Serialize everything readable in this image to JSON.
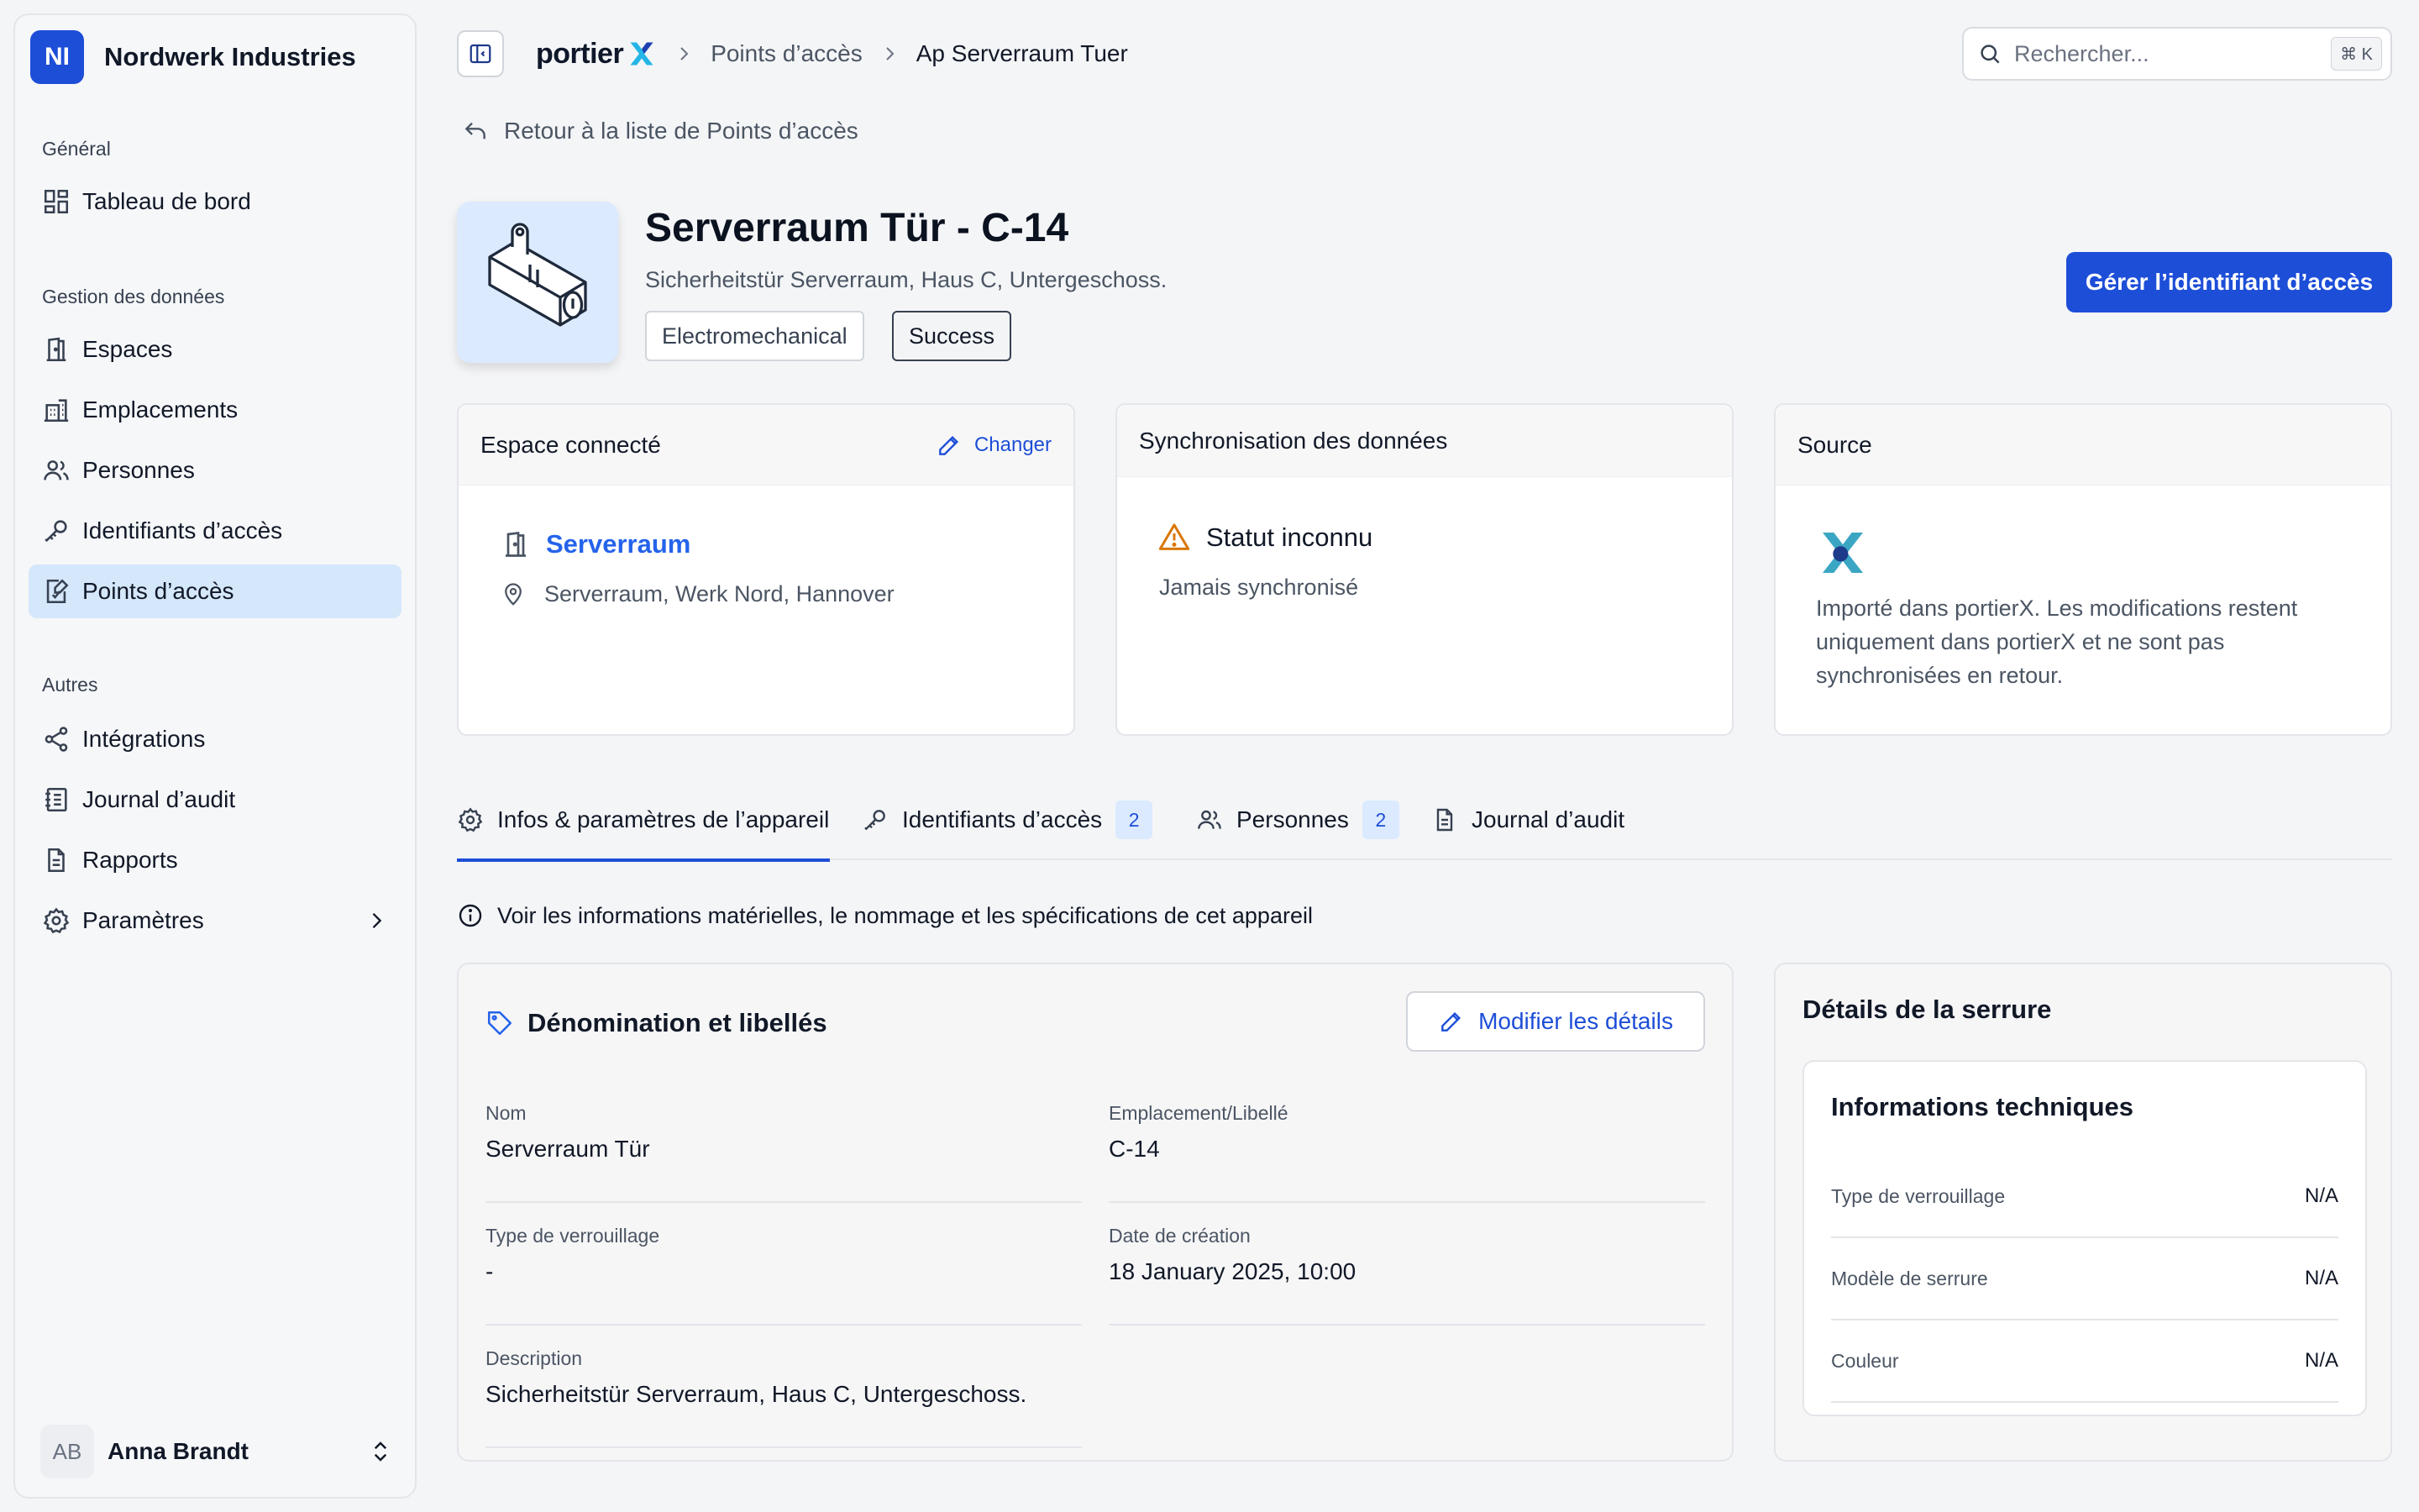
{
  "sidebar": {
    "org_initials": "NI",
    "org_name": "Nordwerk Industries",
    "sections": [
      {
        "title": "Général",
        "items": [
          {
            "label": "Tableau de bord",
            "icon": "dashboard-icon"
          }
        ]
      },
      {
        "title": "Gestion des données",
        "items": [
          {
            "label": "Espaces",
            "icon": "door-icon"
          },
          {
            "label": "Emplacements",
            "icon": "building-icon"
          },
          {
            "label": "Personnes",
            "icon": "users-icon"
          },
          {
            "label": "Identifiants d’accès",
            "icon": "key-icon"
          },
          {
            "label": "Points d’accès",
            "icon": "access-point-icon",
            "active": true
          }
        ]
      },
      {
        "title": "Autres",
        "items": [
          {
            "label": "Intégrations",
            "icon": "share-icon"
          },
          {
            "label": "Journal d’audit",
            "icon": "audit-log-icon"
          },
          {
            "label": "Rapports",
            "icon": "report-icon"
          },
          {
            "label": "Paramètres",
            "icon": "gear-icon"
          }
        ]
      }
    ],
    "user": {
      "initials": "AB",
      "name": "Anna Brandt"
    }
  },
  "topbar": {
    "brand": "portier",
    "breadcrumbs": [
      "Points d’accès",
      "Ap Serverraum Tuer"
    ],
    "search_placeholder": "Rechercher...",
    "search_shortcut": "⌘ K"
  },
  "main": {
    "back_link": "Retour à la liste de Points d’accès",
    "title": "Serverraum Tür - C-14",
    "subtitle": "Sicherheitstür Serverraum, Haus C, Untergeschoss.",
    "chips": [
      "Electromechanical",
      "Success"
    ],
    "primary_button": "Gérer l’identifiant d’accès",
    "connected_space": {
      "title": "Espace connecté",
      "change_label": "Changer",
      "space_name": "Serverraum",
      "location": "Serverraum, Werk Nord, Hannover"
    },
    "sync": {
      "title": "Synchronisation des données",
      "status": "Statut inconnu",
      "detail": "Jamais synchronisé"
    },
    "source": {
      "title": "Source",
      "text": "Importé dans portierX. Les modifications restent uniquement dans portierX et ne sont pas synchronisées en retour."
    },
    "tabs": [
      {
        "label": "Infos & paramètres de l’appareil",
        "icon": "gear-icon",
        "active": true
      },
      {
        "label": "Identifiants d’accès",
        "icon": "key-icon",
        "badge": "2"
      },
      {
        "label": "Personnes",
        "icon": "users-icon",
        "badge": "2"
      },
      {
        "label": "Journal d’audit",
        "icon": "document-icon"
      }
    ],
    "info_line": "Voir les informations matérielles, le nommage et les spécifications de cet appareil",
    "naming": {
      "title": "Dénomination et libellés",
      "edit_button": "Modifier les détails",
      "fields": [
        {
          "label": "Nom",
          "value": "Serverraum Tür"
        },
        {
          "label": "Emplacement/Libellé",
          "value": "C-14"
        },
        {
          "label": "Type de verrouillage",
          "value": "-"
        },
        {
          "label": "Date de création",
          "value": "18 January 2025, 10:00"
        },
        {
          "label": "Description",
          "value": "Sicherheitstür Serverraum, Haus C, Untergeschoss."
        }
      ]
    },
    "lock_details": {
      "title": "Détails de la serrure",
      "tech_title": "Informations techniques",
      "rows": [
        {
          "label": "Type de verrouillage",
          "value": "N/A"
        },
        {
          "label": "Modèle de serrure",
          "value": "N/A"
        },
        {
          "label": "Couleur",
          "value": "N/A"
        }
      ]
    }
  },
  "colors": {
    "accent": "#1d4ed8",
    "link": "#2563eb",
    "active_nav_bg": "#d5e7fb",
    "warning": "#d97706"
  }
}
